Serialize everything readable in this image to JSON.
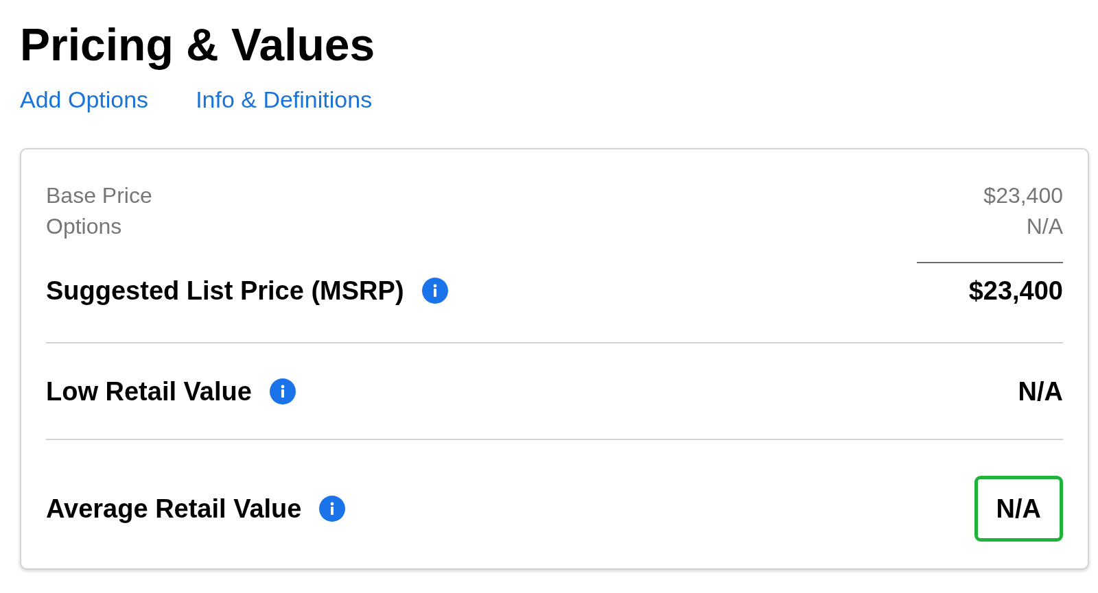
{
  "title": "Pricing & Values",
  "links": [
    "Add Options",
    "Info & Definitions"
  ],
  "card": {
    "breakdown": [
      {
        "label": "Base Price",
        "value": "$23,400"
      },
      {
        "label": "Options",
        "value": "N/A"
      }
    ],
    "rows": [
      {
        "label": "Suggested List Price (MSRP)",
        "value": "$23,400",
        "highlighted": false
      },
      {
        "label": "Low Retail Value",
        "value": "N/A",
        "highlighted": false
      },
      {
        "label": "Average Retail Value",
        "value": "N/A",
        "highlighted": true
      }
    ]
  }
}
